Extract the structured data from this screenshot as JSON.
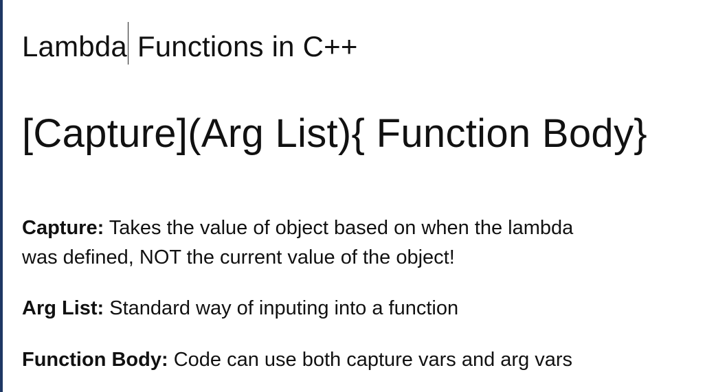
{
  "title": {
    "part1": "Lambda",
    "part2": " Functions in C++"
  },
  "syntax": "[Capture](Arg List){ Function Body}",
  "definitions": [
    {
      "term": "Capture:",
      "text": " Takes the value of object based on when the lambda was defined, NOT the current value of the object!"
    },
    {
      "term": "Arg List:",
      "text": " Standard way of inputing into a function"
    },
    {
      "term": "Function Body:",
      "text": " Code can use both capture vars and arg vars"
    }
  ],
  "colors": {
    "border": "#1f3864",
    "text": "#111111",
    "background": "#ffffff"
  }
}
